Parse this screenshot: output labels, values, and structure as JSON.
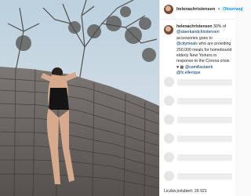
{
  "post": {
    "username": "helenachristensen",
    "separator": "•",
    "follow_label": "Obserwuj",
    "caption": {
      "username": "helenachristensen",
      "text_1": "30% of",
      "mention_1": "@staerkandchristensen",
      "text_2": "accessories goes to",
      "mention_2": "@citymeals",
      "text_3": "who are providing 250,000 meals for homebound elderly New Yorkers in response to the Corona crisis",
      "emoji": "♥ ▦",
      "mention_3": "@camillastaerk",
      "mention_4": "@fc.ellerique"
    },
    "likes_label": "Liczba polubień: 26 921"
  },
  "colors": {
    "accent": "#0095f6",
    "mention": "#00376b",
    "sky": "#c9d9e4",
    "stone": "#6f6c68"
  }
}
